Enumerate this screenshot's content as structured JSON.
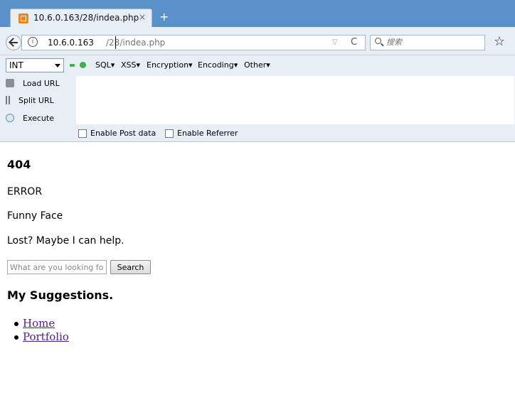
{
  "browser": {
    "tab": {
      "title": "10.6.0.163/28/indea.php",
      "close": "×"
    },
    "newtab": "+",
    "url": {
      "host": "10.6.0.163",
      "path": "/28/indea.php"
    },
    "search": {
      "placeholder": "搜索"
    },
    "bookmark": "☆",
    "reload": "C",
    "dropdown": "▽"
  },
  "hackbar": {
    "select_value": "INT",
    "menus": [
      "SQL▾",
      "XSS▾",
      "Encryption▾",
      "Encoding▾",
      "Other▾"
    ],
    "side": [
      "Load URL",
      "Split URL",
      "Execute"
    ],
    "options": [
      "Enable Post data",
      "Enable Referrer"
    ]
  },
  "page": {
    "title": "404",
    "error": "ERROR",
    "funny": "Funny Face",
    "lost": "Lost? Maybe I can help.",
    "search_placeholder": "What are you looking for?",
    "search_button": "Search",
    "suggestions_title": "My Suggestions.",
    "links": [
      "Home",
      "Portfolio"
    ]
  }
}
